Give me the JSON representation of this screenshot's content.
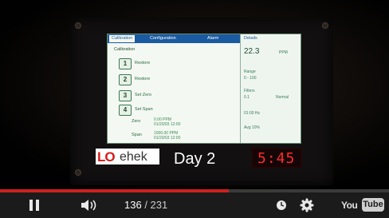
{
  "video": {
    "screen": {
      "tabs": [
        "Calibration",
        "Configuration",
        "Alarm"
      ],
      "right_tab": "Details",
      "calibration_title": "Calibration",
      "steps": [
        {
          "num": "1",
          "label": "Restore"
        },
        {
          "num": "2",
          "label": "Restore"
        },
        {
          "num": "3",
          "label": "Set Zero"
        },
        {
          "num": "4",
          "label": "Set Span"
        }
      ],
      "zero_key": "Zero",
      "zero_val1": "0.00 PPM",
      "zero_val2": "01/20/03 12:00",
      "span_key": "Span",
      "span_val1": "1000.00 PPM",
      "span_val2": "01/20/03 12:00",
      "right_big": "22.3",
      "right_items": [
        "PPM",
        "Range",
        "0 - 100",
        "Filters",
        "0.1",
        "Normal",
        "01:00 Hz",
        "Avg 10%"
      ]
    },
    "logo_lo": "LO",
    "logo_rest": "ehek",
    "day_label": "Day 2",
    "clock_text": "5:45"
  },
  "player": {
    "current_time": "136",
    "separator": " / ",
    "duration": "231",
    "progress_fraction": 0.589,
    "brand_you": "You",
    "brand_tube": "Tube",
    "accent_color": "#d0201e"
  }
}
